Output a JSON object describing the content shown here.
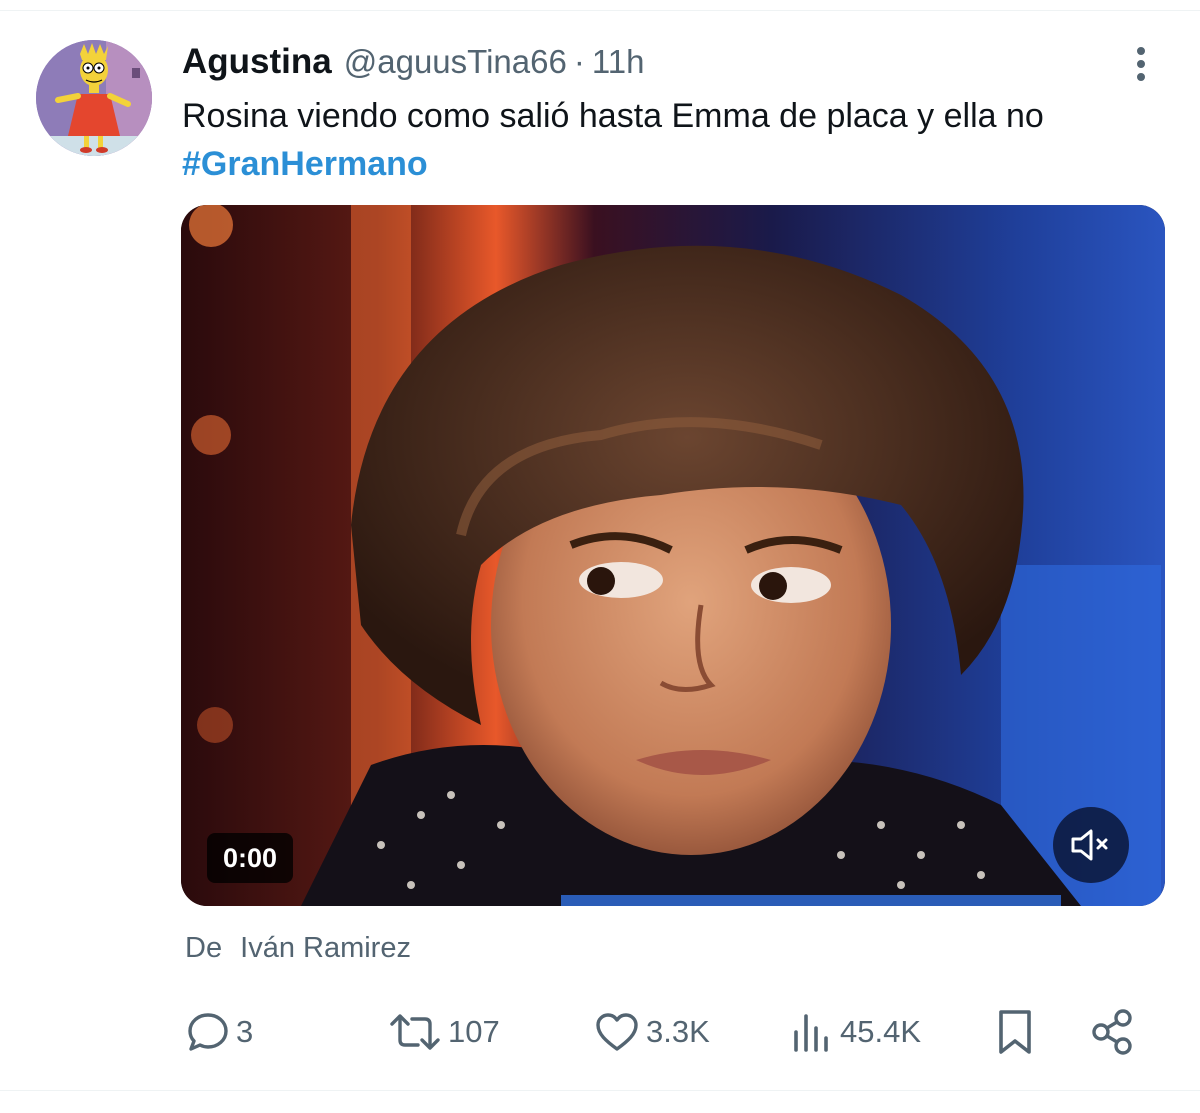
{
  "tweet": {
    "display_name": "Agustina",
    "handle": "@aguusTina66",
    "separator": "·",
    "time": "11h",
    "text": "Rosina viendo como salió hasta Emma de placa y ella no",
    "hashtag": "#GranHermano",
    "avatar_icon": "cartoon-avatar",
    "more_icon": "vertical-ellipsis-icon"
  },
  "media": {
    "timestamp": "0:00",
    "mute_icon": "speaker-muted-icon"
  },
  "attribution": {
    "prefix": "De",
    "name": "Iván Ramirez"
  },
  "actions": {
    "replies": "3",
    "retweets": "107",
    "likes": "3.3K",
    "views": "45.4K"
  },
  "colors": {
    "text_primary": "#0f1419",
    "text_secondary": "#536471",
    "hashtag": "#2b8fd6",
    "divider": "#eff3f4"
  }
}
